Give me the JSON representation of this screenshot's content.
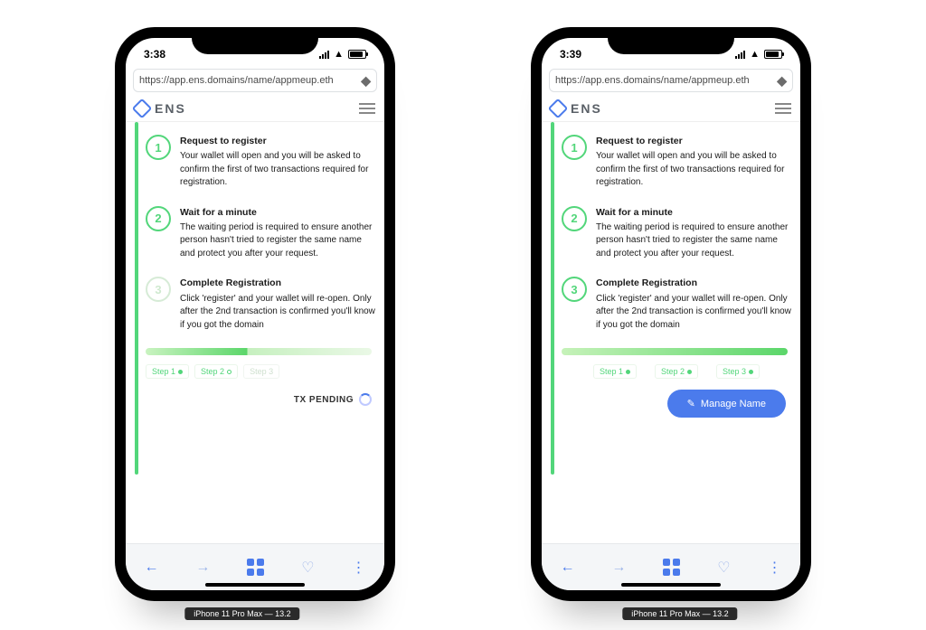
{
  "leftPhone": {
    "time": "3:38",
    "url": "https://app.ens.domains/name/appmeup.eth",
    "brand": "ENS",
    "steps": [
      {
        "number": "1",
        "active": true,
        "title": "Request to register",
        "body": "Your wallet will open and you will be asked to confirm the first of two transactions required for registration."
      },
      {
        "number": "2",
        "active": true,
        "title": "Wait for a minute",
        "body": "The waiting period is required to ensure another person hasn't tried to register the same name and protect you after your request."
      },
      {
        "number": "3",
        "active": false,
        "title": "Complete Registration",
        "body": "Click 'register' and your wallet will re-open. Only after the 2nd transaction is confirmed you'll know if you got the domain"
      }
    ],
    "miniSteps": [
      {
        "label": "Step 1",
        "state": "done"
      },
      {
        "label": "Step 2",
        "state": "current"
      },
      {
        "label": "Step 3",
        "state": "upcoming"
      }
    ],
    "txPending": "TX PENDING",
    "caption": "iPhone 11 Pro Max — 13.2"
  },
  "rightPhone": {
    "time": "3:39",
    "url": "https://app.ens.domains/name/appmeup.eth",
    "brand": "ENS",
    "steps": [
      {
        "number": "1",
        "active": true,
        "title": "Request to register",
        "body": "Your wallet will open and you will be asked to confirm the first of two transactions required for registration."
      },
      {
        "number": "2",
        "active": true,
        "title": "Wait for a minute",
        "body": "The waiting period is required to ensure another person hasn't tried to register the same name and protect you after your request."
      },
      {
        "number": "3",
        "active": true,
        "title": "Complete Registration",
        "body": "Click 'register' and your wallet will re-open. Only after the 2nd transaction is confirmed you'll know if you got the domain"
      }
    ],
    "miniSteps": [
      {
        "label": "Step 1",
        "state": "done"
      },
      {
        "label": "Step 2",
        "state": "done"
      },
      {
        "label": "Step 3",
        "state": "done"
      }
    ],
    "manage": "Manage Name",
    "caption": "iPhone 11 Pro Max — 13.2"
  }
}
